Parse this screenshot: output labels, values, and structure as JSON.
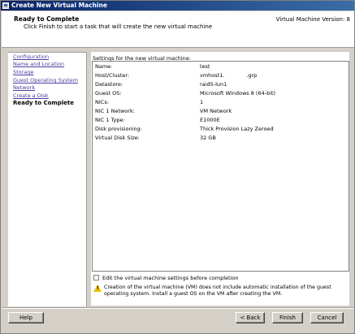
{
  "window": {
    "title": "Create New Virtual Machine"
  },
  "header": {
    "title": "Ready to Complete",
    "subtitle": "Click Finish to start a task that will create the new virtual machine",
    "version": "Virtual Machine Version: 8"
  },
  "nav": {
    "items": [
      {
        "label": "Configuration"
      },
      {
        "label": "Name and Location"
      },
      {
        "label": "Storage"
      },
      {
        "label": "Guest Operating System"
      },
      {
        "label": "Network"
      },
      {
        "label": "Create a Disk"
      },
      {
        "label": "Ready to Complete"
      }
    ],
    "active_index": 6
  },
  "settings": {
    "title": "Settings for the new virtual machine:",
    "rows": [
      {
        "key": "Name:",
        "value": "test"
      },
      {
        "key": "Host/Cluster:",
        "value": "vmhost1.             .grp"
      },
      {
        "key": "Datastore:",
        "value": "raid5-lun1"
      },
      {
        "key": "Guest OS:",
        "value": "Microsoft Windows 8 (64-bit)"
      },
      {
        "key": "NICs:",
        "value": "1"
      },
      {
        "key": "NIC 1 Network:",
        "value": "VM Network"
      },
      {
        "key": "NIC 1 Type:",
        "value": "E1000E"
      },
      {
        "key": "Disk provisioning:",
        "value": "Thick Provision Lazy Zeroed"
      },
      {
        "key": "Virtual Disk Size:",
        "value": "32 GB"
      }
    ]
  },
  "edit_checkbox": {
    "label": "Edit the virtual machine settings before completion",
    "checked": false
  },
  "warning": {
    "text": "Creation of the virtual machine (VM) does not include automatic installation of the guest operating system. Install a guest OS on the VM after creating the VM."
  },
  "buttons": {
    "help": "Help",
    "back": "< Back",
    "finish": "Finish",
    "cancel": "Cancel"
  }
}
